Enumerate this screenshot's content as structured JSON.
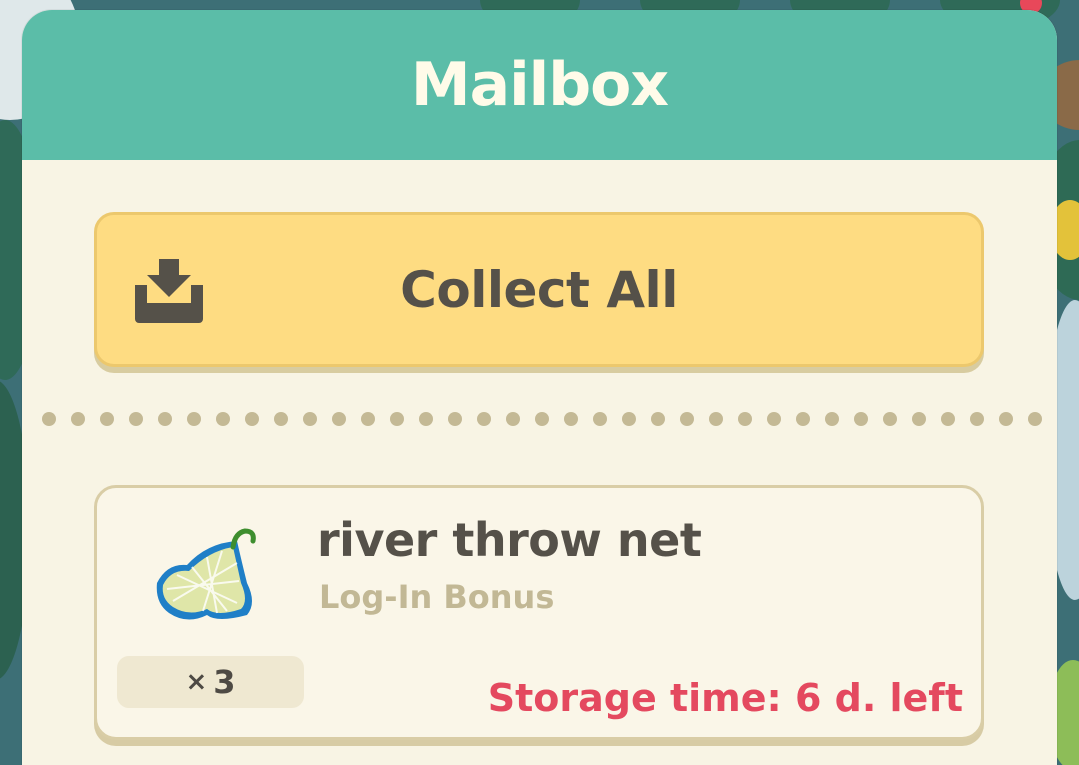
{
  "dialog": {
    "title": "Mailbox"
  },
  "collect_all": {
    "label": "Collect All",
    "icon": "download-tray-icon"
  },
  "mail_items": [
    {
      "name": "river throw net",
      "source": "Log-In Bonus",
      "quantity_prefix": "×",
      "quantity": "3",
      "storage": "Storage time: 6 d. left",
      "icon": "throw-net-icon"
    }
  ],
  "colors": {
    "header": "#5bbda8",
    "panel": "#f8f4e4",
    "button": "#fedc82",
    "storage_text": "#e4495f"
  }
}
